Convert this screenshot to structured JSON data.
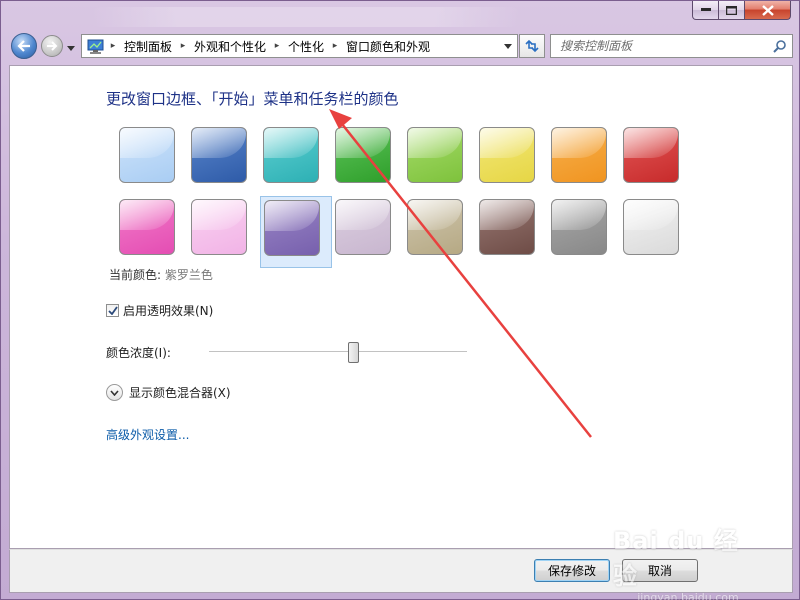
{
  "window": {
    "caption_colors": {
      "close": "#c7432c"
    }
  },
  "nav": {
    "address_crumbs": [
      "控制面板",
      "外观和个性化",
      "个性化",
      "窗口颜色和外观"
    ],
    "search_placeholder": "搜索控制面板"
  },
  "content": {
    "title": "更改窗口边框、「开始」菜单和任务栏的颜色",
    "swatches_row1": [
      {
        "color": "#cfe4fb",
        "dark": "#a9cdf3"
      },
      {
        "color": "#5a86cc",
        "dark": "#2e5ba8"
      },
      {
        "color": "#5fd0d2",
        "dark": "#2db0b4"
      },
      {
        "color": "#5ec45a",
        "dark": "#2f9f2b"
      },
      {
        "color": "#a6dc6a",
        "dark": "#7ec23c"
      },
      {
        "color": "#f3e878",
        "dark": "#e6d645"
      },
      {
        "color": "#f7b14e",
        "dark": "#f09420"
      },
      {
        "color": "#e35757",
        "dark": "#c72b2b"
      }
    ],
    "swatches_row2": [
      {
        "color": "#f27cc9",
        "dark": "#e44db3"
      },
      {
        "color": "#fad2f1",
        "dark": "#f1b3e6"
      },
      {
        "color": "#9a86c6",
        "dark": "#7760ad"
      },
      {
        "color": "#dccfe0",
        "dark": "#c8b6cf"
      },
      {
        "color": "#cfc6ae",
        "dark": "#b6a984"
      },
      {
        "color": "#987873",
        "dark": "#6e4c46"
      },
      {
        "color": "#a9a9a9",
        "dark": "#888888"
      },
      {
        "color": "#f3f3f3",
        "dark": "#dadada"
      }
    ],
    "selected_swatch_index": 10,
    "current_color_label": "当前颜色:",
    "current_color_value": "紫罗兰色",
    "transparency_label": "启用透明效果(N)",
    "transparency_checked": true,
    "intensity_label": "颜色浓度(I):",
    "intensity_level": 0.56,
    "mixer_label": "显示颜色混合器(X)",
    "advanced_link": "高级外观设置..."
  },
  "buttons": {
    "save_label": "保存修改",
    "cancel_label": "取消"
  },
  "watermark": {
    "text": "Bai du 经验",
    "sub": "jingyan.baidu.com"
  },
  "annotation": {
    "arrow_color": "#e8413f"
  }
}
